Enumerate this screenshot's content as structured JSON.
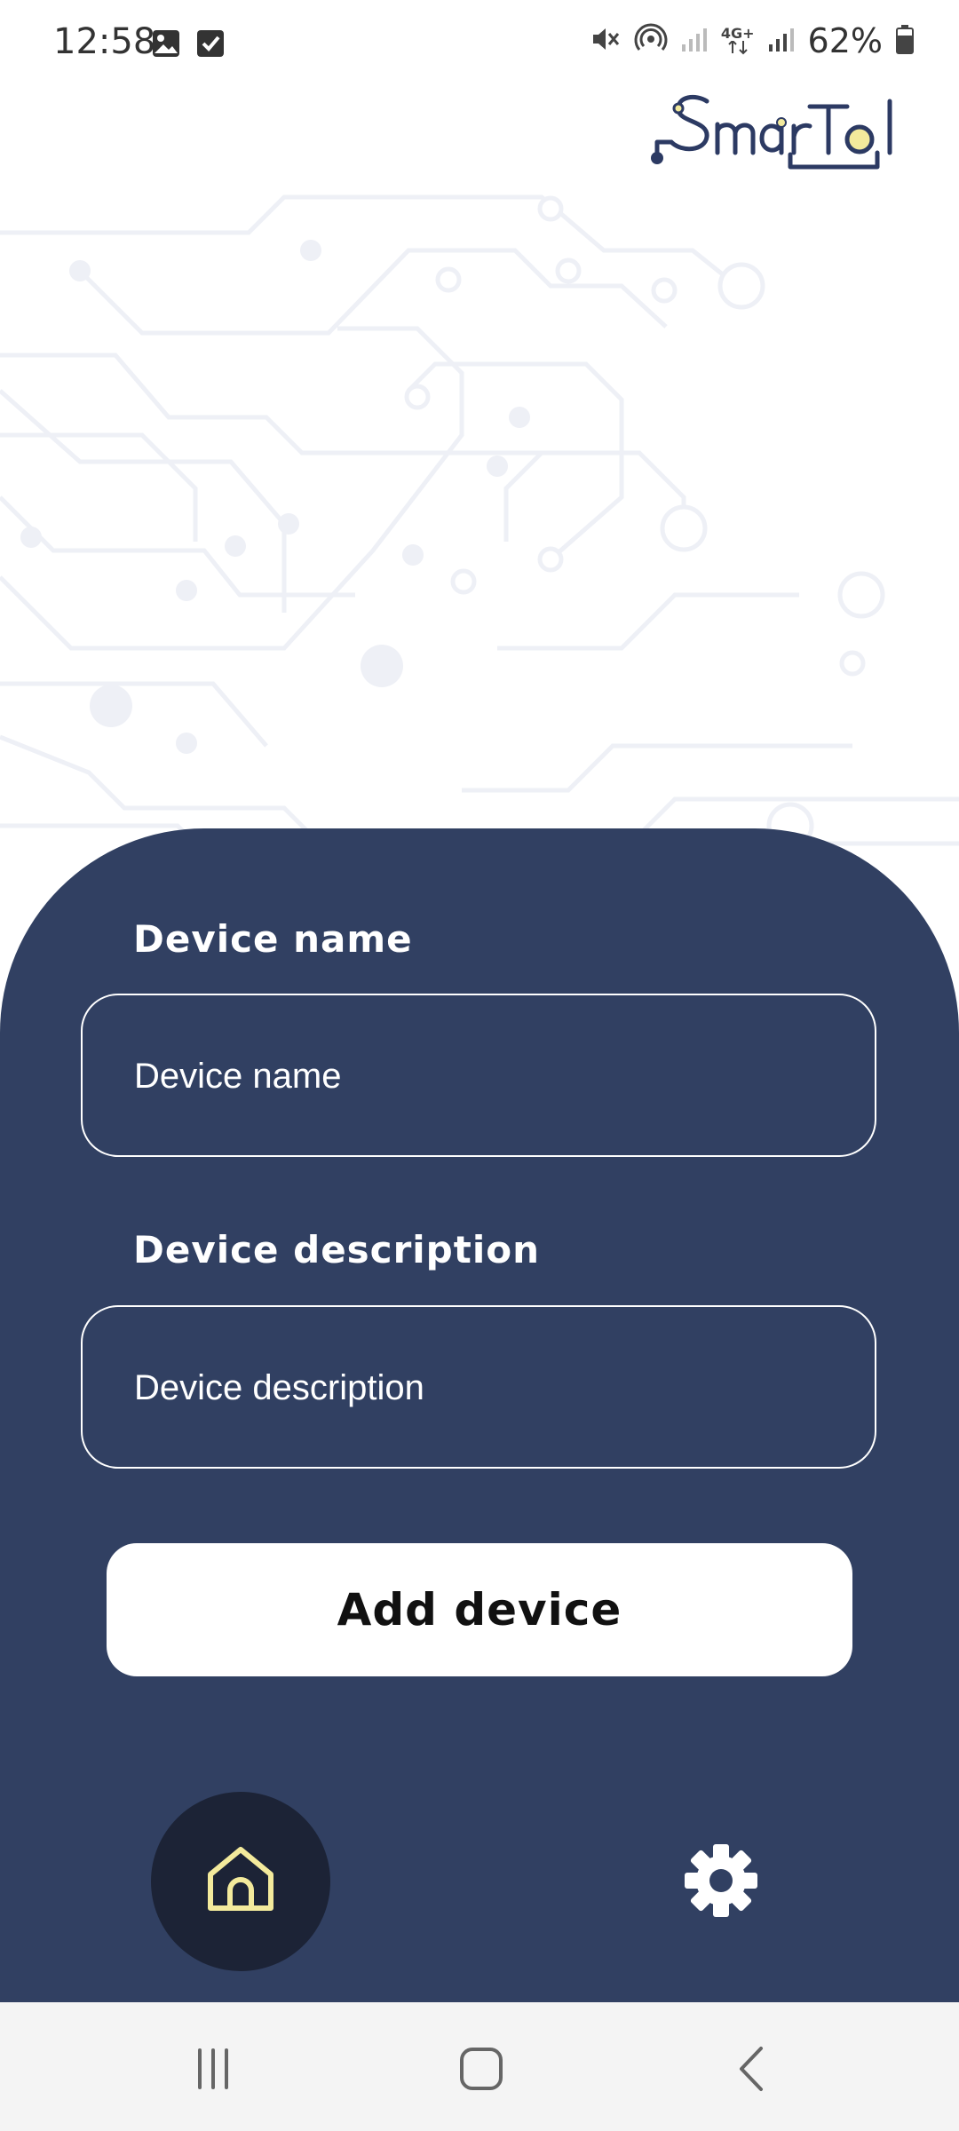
{
  "status_bar": {
    "time": "12:58",
    "battery_percent": "62%",
    "network_label": "4G+",
    "icons": [
      "image-icon",
      "checkbox-icon",
      "mute-icon",
      "hotspot-icon",
      "signal-icon",
      "network-4g-icon",
      "signal-icon",
      "battery-icon"
    ]
  },
  "logo": {
    "text": "SmarTol"
  },
  "form": {
    "name_label": "Device name",
    "name_placeholder": "Device name",
    "description_label": "Device description",
    "description_placeholder": "Device description",
    "submit_label": "Add device"
  },
  "bottom_nav": {
    "items": [
      {
        "icon": "home-icon",
        "active": true
      },
      {
        "icon": "gear-icon",
        "active": false
      }
    ]
  },
  "system_nav": {
    "icons": [
      "recent-apps-icon",
      "home-circle-icon",
      "back-icon"
    ]
  },
  "colors": {
    "panel": "#314062",
    "home_active_bg": "#1c2336",
    "accent": "#f3ea9c",
    "logo": "#2c3a63"
  }
}
